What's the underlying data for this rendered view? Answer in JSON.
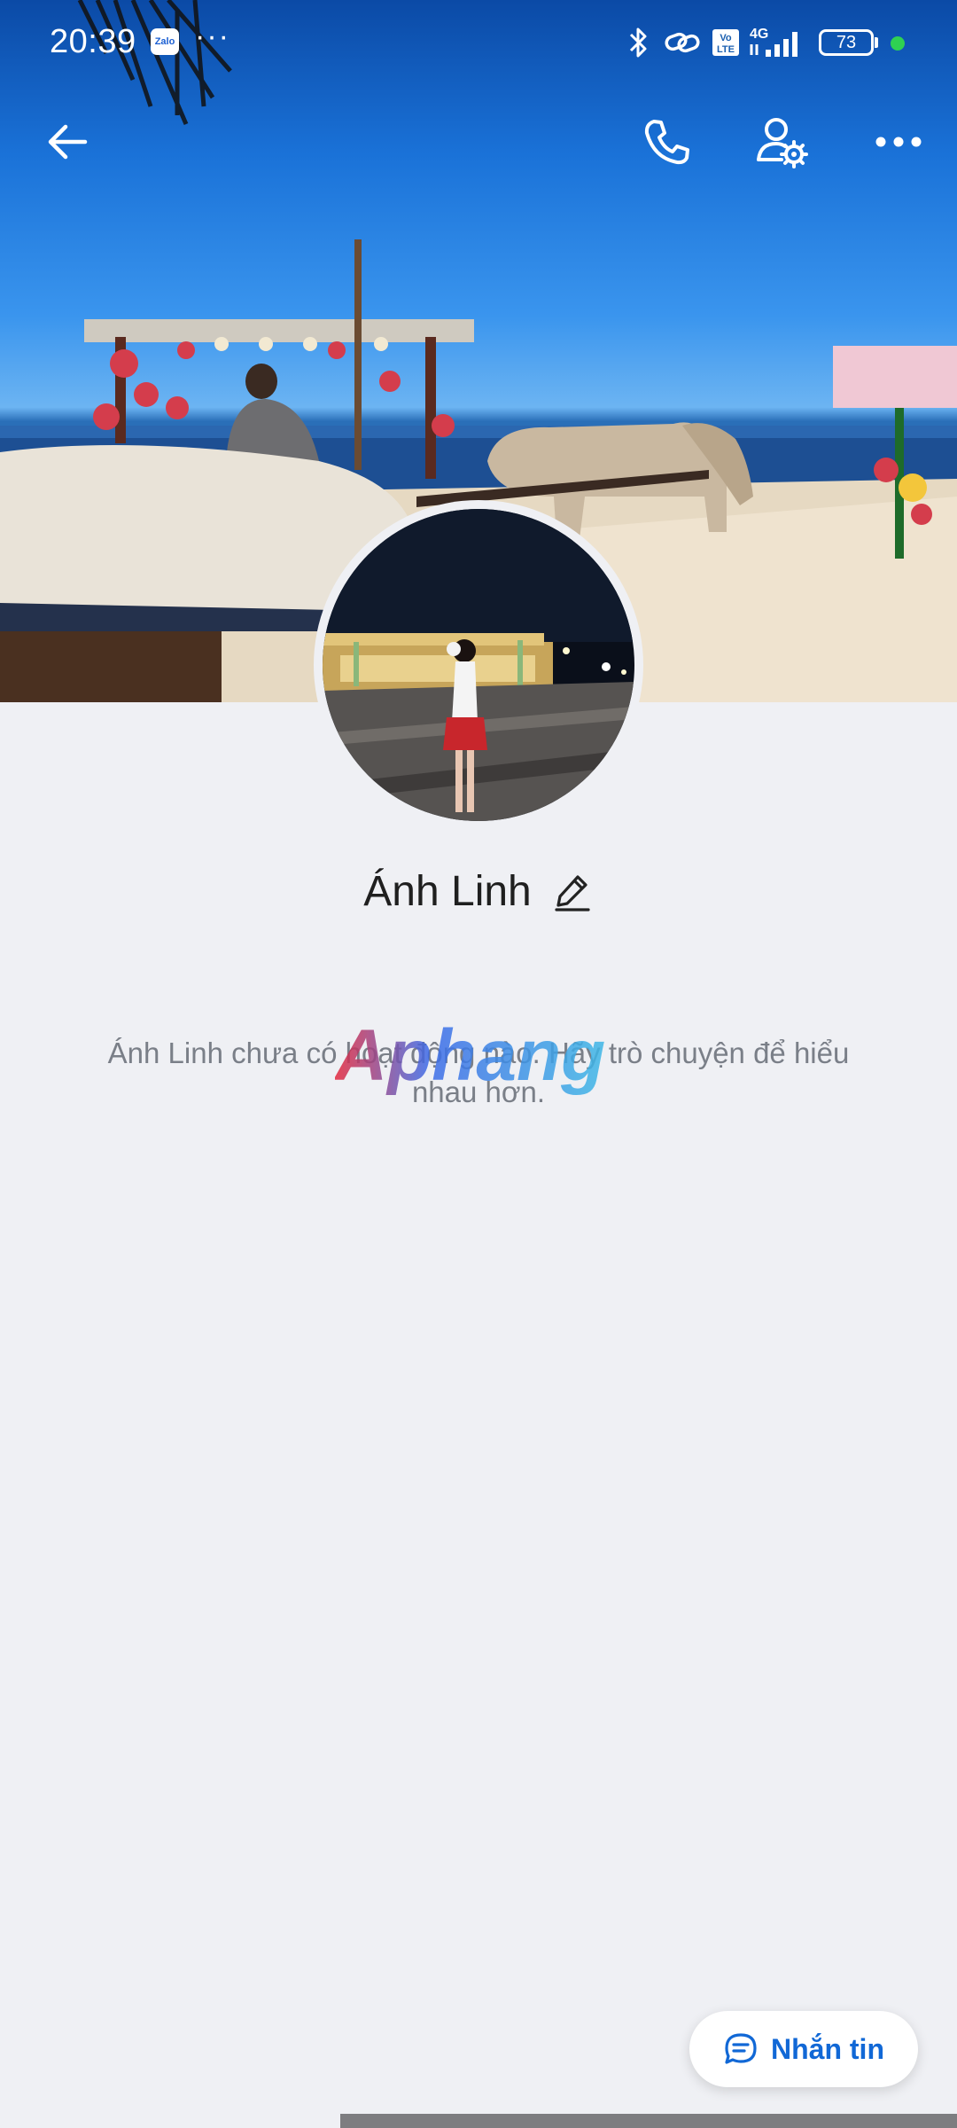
{
  "status_bar": {
    "time": "20:39",
    "app_badge": "Zalo",
    "more_indicator": "···",
    "network_volte": "Vo LTE",
    "network_type": "4G",
    "battery_level": "73",
    "icons": [
      "bluetooth-icon",
      "link-icon",
      "volte-icon",
      "signal-icon",
      "battery-icon"
    ]
  },
  "top_bar": {
    "back_icon": "back-arrow-icon",
    "call_icon": "phone-icon",
    "profile_settings_icon": "user-settings-icon",
    "more_icon": "more-icon"
  },
  "profile": {
    "name": "Ánh Linh",
    "edit_icon": "pencil-icon"
  },
  "activity": {
    "empty_message": "Ánh Linh chưa có hoạt động nào. Hãy trò chuyện để hiểu nhau hơn."
  },
  "watermark": {
    "text": "Aphang"
  },
  "message_button": {
    "label": "Nhắn tin",
    "icon": "chat-bubble-icon"
  },
  "colors": {
    "background": "#eff0f4",
    "accent": "#1168d6",
    "name_text": "#1f1f1f",
    "muted_text": "#7a7f88"
  }
}
